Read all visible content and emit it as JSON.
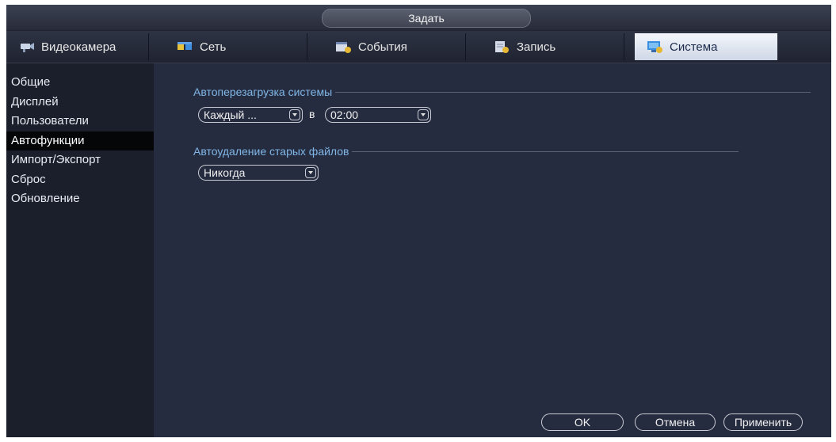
{
  "window": {
    "title": "Задать"
  },
  "tabs": [
    {
      "label": "Видеокамера",
      "icon": "camera-icon",
      "active": false
    },
    {
      "label": "Сеть",
      "icon": "network-icon",
      "active": false
    },
    {
      "label": "События",
      "icon": "events-icon",
      "active": false
    },
    {
      "label": "Запись",
      "icon": "record-icon",
      "active": false
    },
    {
      "label": "Система",
      "icon": "system-icon",
      "active": true
    }
  ],
  "sidebar": {
    "items": [
      {
        "label": "Общие"
      },
      {
        "label": "Дисплей"
      },
      {
        "label": "Пользователи"
      },
      {
        "label": "Автофункции",
        "active": true
      },
      {
        "label": "Импорт/Экспорт"
      },
      {
        "label": "Сброс"
      },
      {
        "label": "Обновление"
      }
    ]
  },
  "auto_reboot": {
    "title": "Автоперезагрузка системы",
    "period_value": "Каждый ...",
    "at_label": "в",
    "time_value": "02:00"
  },
  "auto_delete": {
    "title": "Автоудаление старых файлов",
    "value": "Никогда"
  },
  "buttons": {
    "ok": "OK",
    "cancel": "Отмена",
    "apply": "Применить"
  },
  "colors": {
    "background": "#202536",
    "panel": "#262c40",
    "section_title": "#7fb6e6",
    "active_tab": "#e4ebf5"
  }
}
